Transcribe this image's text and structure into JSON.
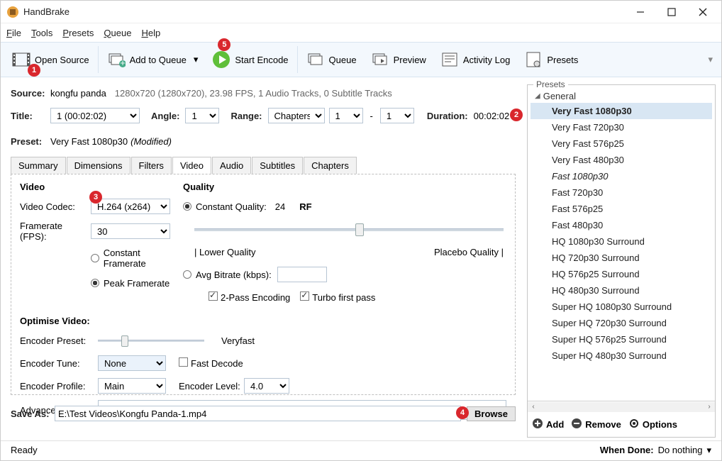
{
  "titlebar": {
    "app": "HandBrake"
  },
  "menubar": {
    "file": "File",
    "tools": "Tools",
    "presets": "Presets",
    "queue": "Queue",
    "help": "Help"
  },
  "toolbar": {
    "open_source": "Open Source",
    "add_queue": "Add to Queue",
    "start_encode": "Start Encode",
    "queue": "Queue",
    "preview": "Preview",
    "activity_log": "Activity Log",
    "presets": "Presets"
  },
  "markers": {
    "m1": "1",
    "m2": "2",
    "m3": "3",
    "m4": "4",
    "m5": "5"
  },
  "source": {
    "label": "Source:",
    "name": "kongfu panda",
    "info": "1280x720 (1280x720), 23.98 FPS, 1 Audio Tracks, 0 Subtitle Tracks"
  },
  "title": {
    "label": "Title:",
    "value": "1 (00:02:02)"
  },
  "angle": {
    "label": "Angle:",
    "value": "1"
  },
  "range": {
    "label": "Range:",
    "type": "Chapters",
    "from": "1",
    "sep": "-",
    "to": "1"
  },
  "duration": {
    "label": "Duration:",
    "value": "00:02:02"
  },
  "preset_row": {
    "label": "Preset:",
    "value": "Very Fast 1080p30",
    "mod": "(Modified)"
  },
  "tabs": [
    "Summary",
    "Dimensions",
    "Filters",
    "Video",
    "Audio",
    "Subtitles",
    "Chapters"
  ],
  "video_tab": {
    "video_header": "Video",
    "quality_header": "Quality",
    "codec_label": "Video Codec:",
    "codec_value": "H.264 (x264)",
    "fps_label": "Framerate (FPS):",
    "fps_value": "30",
    "constant_fps": "Constant Framerate",
    "peak_fps": "Peak Framerate",
    "constant_q": "Constant Quality:",
    "cq_value": "24",
    "rf_label": "RF",
    "lower_q": "| Lower Quality",
    "placebo_q": "Placebo Quality |",
    "avg_bitrate": "Avg Bitrate (kbps):",
    "two_pass": "2-Pass Encoding",
    "turbo": "Turbo first pass",
    "optimise": "Optimise Video:",
    "enc_preset_label": "Encoder Preset:",
    "enc_preset_value": "Veryfast",
    "enc_tune_label": "Encoder Tune:",
    "enc_tune_value": "None",
    "fast_decode": "Fast Decode",
    "enc_profile_label": "Encoder Profile:",
    "enc_profile_value": "Main",
    "enc_level_label": "Encoder Level:",
    "enc_level_value": "4.0",
    "adv_opts": "Advanced Options:"
  },
  "save": {
    "label": "Save As:",
    "path": "E:\\Test Videos\\Kongfu Panda-1.mp4",
    "browse": "Browse"
  },
  "presets_panel": {
    "legend": "Presets",
    "group_general": "General",
    "items": [
      {
        "label": "Very Fast 1080p30",
        "sel": true
      },
      {
        "label": "Very Fast 720p30"
      },
      {
        "label": "Very Fast 576p25"
      },
      {
        "label": "Very Fast 480p30"
      },
      {
        "label": "Fast 1080p30",
        "ital": true
      },
      {
        "label": "Fast 720p30"
      },
      {
        "label": "Fast 576p25"
      },
      {
        "label": "Fast 480p30"
      },
      {
        "label": "HQ 1080p30 Surround"
      },
      {
        "label": "HQ 720p30 Surround"
      },
      {
        "label": "HQ 576p25 Surround"
      },
      {
        "label": "HQ 480p30 Surround"
      },
      {
        "label": "Super HQ 1080p30 Surround"
      },
      {
        "label": "Super HQ 720p30 Surround"
      },
      {
        "label": "Super HQ 576p25 Surround"
      },
      {
        "label": "Super HQ 480p30 Surround"
      }
    ],
    "add": "Add",
    "remove": "Remove",
    "options": "Options"
  },
  "statusbar": {
    "ready": "Ready",
    "when_done_label": "When Done:",
    "when_done_value": "Do nothing"
  }
}
